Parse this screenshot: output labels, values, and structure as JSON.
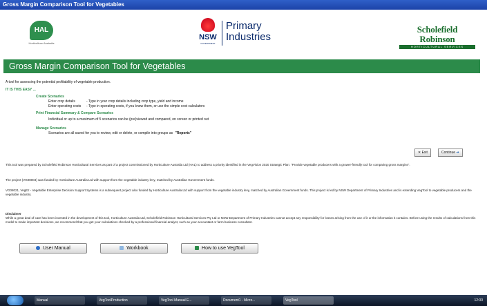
{
  "window": {
    "title": "Gross Margin Comparison Tool for Vegetables"
  },
  "logos": {
    "hal": {
      "abbr": "HAL",
      "subtitle": "Horticulture Australia"
    },
    "nsw": {
      "short": "NSW",
      "gov": "GOVERNMENT",
      "line1": "Primary",
      "line2": "Industries"
    },
    "sr": {
      "name": "Scholefield Robinson",
      "sub": "HORTICULTURAL SERVICES"
    }
  },
  "banner": {
    "title": "Gross Margin Comparison Tool for Vegetables"
  },
  "intro": "A tool for assessing the potential profitability of vegetable production.",
  "easy": "IT IS THIS EASY ...",
  "sections": {
    "create": {
      "heading": "Create Scenarios",
      "rows": [
        {
          "label": "Enter crop details",
          "desc": "- Type in your crop details including crop type, yield and income"
        },
        {
          "label": "Enter operating costs",
          "desc": "- Type in operating costs, if you know them, or use the simple cost calculators"
        }
      ]
    },
    "print": {
      "heading": "Print Financial Summary & Compare Scenarios",
      "text": "Individual or up to a maximum of 5 scenarios can be (pre)viewed and compared, on screen or printed out"
    },
    "manage": {
      "heading": "Manage Scenarios",
      "text": "Scenarios are all saved for you to review, edit or delete, or compile into groups as",
      "reports": "\"Reports\""
    }
  },
  "buttons": {
    "exit": "Exit",
    "continue": "Continue",
    "manual": "User Manual",
    "workbook": "Workbook",
    "howto": "How to use VegTool"
  },
  "paragraphs": {
    "p1": "This tool was prepared by Scholefield Robinson Horticultural Services as part of a project commissioned by Horticulture Australia Ltd (HAL) to address a priority identified in the VegVision 2020 Strategic Plan: \"Provide vegetable producers with a grower-friendly tool for comparing gross margins\".",
    "p2": "The project (VG08004) was funded by Horticulture Australia Ltd with support from the vegetable industry levy, matched by Australian Government funds.",
    "p3": "VG08021, VegEz - Vegetable Enterprise Decision Support Systems is a subsequent project also funded by Horticulture Australia Ltd with support from the vegetable industry levy, matched by Australian Government funds. This project is led by NSW Department of Primary Industries and is extending VegTool to vegetable producers and the vegetable industry.",
    "disclaimer_title": "Disclaimer",
    "disclaimer": "While a great deal of care has been invested in the development of this tool, Horticulture Australia Ltd, Scholefield Robinson Horticultural Services Pty Ltd or NSW Department of Primary Industries cannot accept any responsibility for losses arising from the use of it or the information it contains. Before using the results of calculations from this model to make important decisions, we recommend that you get your calculations checked by a professional financial analyst, such as your accountant or farm business consultant."
  },
  "taskbar": {
    "items": [
      "Manual",
      "VegToolProduction",
      "VegTool Manual E...",
      "Document1 - Micro...",
      "VegTool"
    ],
    "clock": "12:00"
  }
}
